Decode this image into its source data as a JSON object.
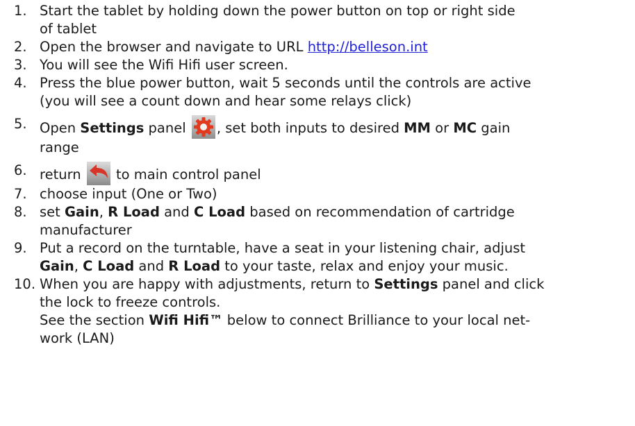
{
  "steps": [
    {
      "num": "1.",
      "line1": "Start the tablet by holding down the power button on top or right side",
      "line2": "of tablet"
    },
    {
      "num": "2.",
      "text": "Open the browser and navigate to URL ",
      "link": "http://belleson.int"
    },
    {
      "num": "3.",
      "text": "You will see the Wifi Hifi user screen."
    },
    {
      "num": "4.",
      "line1": "Press the blue power button, wait 5 seconds until the controls are active",
      "line2": "(you will see a count down and hear some relays click)"
    },
    {
      "num": "5.",
      "t1": "Open ",
      "b1": "Settings",
      "t2": " panel ",
      "icon": "gear-icon",
      "t3": ", set both inputs to desired ",
      "b2": "MM",
      "t4": " or ",
      "b3": "MC",
      "t5": " gain",
      "line2": "range"
    },
    {
      "num": "6.",
      "t1": "return ",
      "icon": "return-arrow-icon",
      "t2": " to main control panel"
    },
    {
      "num": "7.",
      "text": "choose input (One or Two)"
    },
    {
      "num": "8.",
      "t1": "set ",
      "b1": "Gain",
      "t2": ", ",
      "b2": "R Load",
      "t3": " and ",
      "b3": "C Load",
      "t4": " based on recommendation of cartridge",
      "line2": "manufacturer"
    },
    {
      "num": "9.",
      "line1": "Put a record on the turntable, have a seat in your listening chair, adjust",
      "b1": "Gain",
      "t2": ", ",
      "b2": "C Load",
      "t3": " and ",
      "b3": "R Load",
      "t4": " to your taste, relax and enjoy your music."
    },
    {
      "num": "10.",
      "t1": "When you are happy with adjustments, return to ",
      "b1": "Settings",
      "t2": " panel and click",
      "line2": "the lock to freeze controls.",
      "t3": "See the section ",
      "b2": "Wifi Hifi™",
      "t4": " below to connect Brilliance to your local net-",
      "line4": "work (LAN)"
    }
  ]
}
